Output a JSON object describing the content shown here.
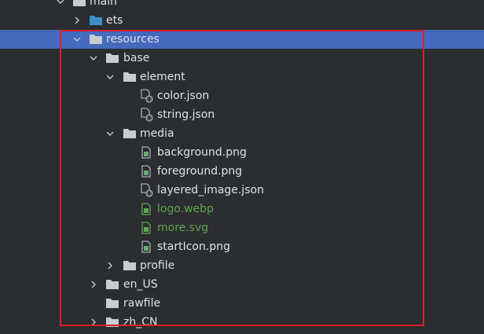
{
  "tree": {
    "rows": [
      {
        "label": "main"
      },
      {
        "label": "ets"
      },
      {
        "label": "resources"
      },
      {
        "label": "base"
      },
      {
        "label": "element"
      },
      {
        "label": "color.json"
      },
      {
        "label": "string.json"
      },
      {
        "label": "media"
      },
      {
        "label": "background.png"
      },
      {
        "label": "foreground.png"
      },
      {
        "label": "layered_image.json"
      },
      {
        "label": "logo.webp"
      },
      {
        "label": "more.svg"
      },
      {
        "label": "startIcon.png"
      },
      {
        "label": "profile"
      },
      {
        "label": "en_US"
      },
      {
        "label": "rawfile"
      },
      {
        "label": "zh_CN"
      }
    ]
  },
  "colors": {
    "background": "#2b2d30",
    "selected_row": "#4569bd",
    "text": "#dfe1e5",
    "vcs_added_green": "#5fa54f",
    "highlight_border": "#d9202b",
    "folder_blue": "#3d8ec9",
    "folder_gray": "#c9ccd1"
  },
  "icons": {
    "expanded": "chevron-down-icon",
    "collapsed": "chevron-right-icon",
    "source_folder": "folder-blue-icon",
    "folder": "folder-icon",
    "json_file": "json-file-icon",
    "image_file": "image-file-icon"
  }
}
